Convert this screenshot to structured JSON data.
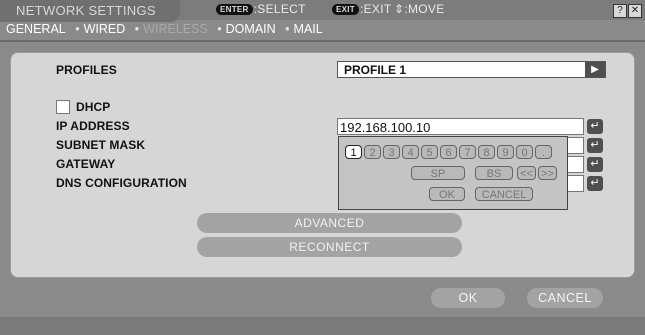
{
  "window": {
    "title": "NETWORK SETTINGS",
    "help_label": "?",
    "close_label": "✕"
  },
  "tabs": [
    {
      "label": "GENERAL",
      "active": true
    },
    {
      "label": "WIRED",
      "active": true
    },
    {
      "label": "WIRELESS",
      "active": false
    },
    {
      "label": "DOMAIN",
      "active": true
    },
    {
      "label": "MAIL",
      "active": true
    }
  ],
  "tab_separator": "•",
  "form": {
    "profiles_label": "PROFILES",
    "profile_value": "PROFILE 1",
    "profile_arrow": "▶",
    "dhcp_label": "DHCP",
    "ip_label": "IP ADDRESS",
    "ip_value": "192.168.100.10",
    "subnet_label": "SUBNET MASK",
    "gateway_label": "GATEWAY",
    "dns_label": "DNS CONFIGURATION",
    "enter_glyph": "↵"
  },
  "keypad": {
    "digits": [
      "1",
      "2",
      "3",
      "4",
      "5",
      "6",
      "7",
      "8",
      "9",
      "0"
    ],
    "dot": ".",
    "sp_label": "SP",
    "bs_label": "BS",
    "left_label": "<<",
    "right_label": ">>",
    "ok_label": "OK",
    "cancel_label": "CANCEL"
  },
  "actions": {
    "advanced_label": "ADVANCED",
    "reconnect_label": "RECONNECT",
    "ok_label": "OK",
    "cancel_label": "CANCEL"
  },
  "footer": {
    "enter_badge": "ENTER",
    "select_label": ":SELECT",
    "exit_badge": "EXIT",
    "exit_label": ":EXIT",
    "move_glyph": "⇕",
    "move_label": ":MOVE"
  }
}
